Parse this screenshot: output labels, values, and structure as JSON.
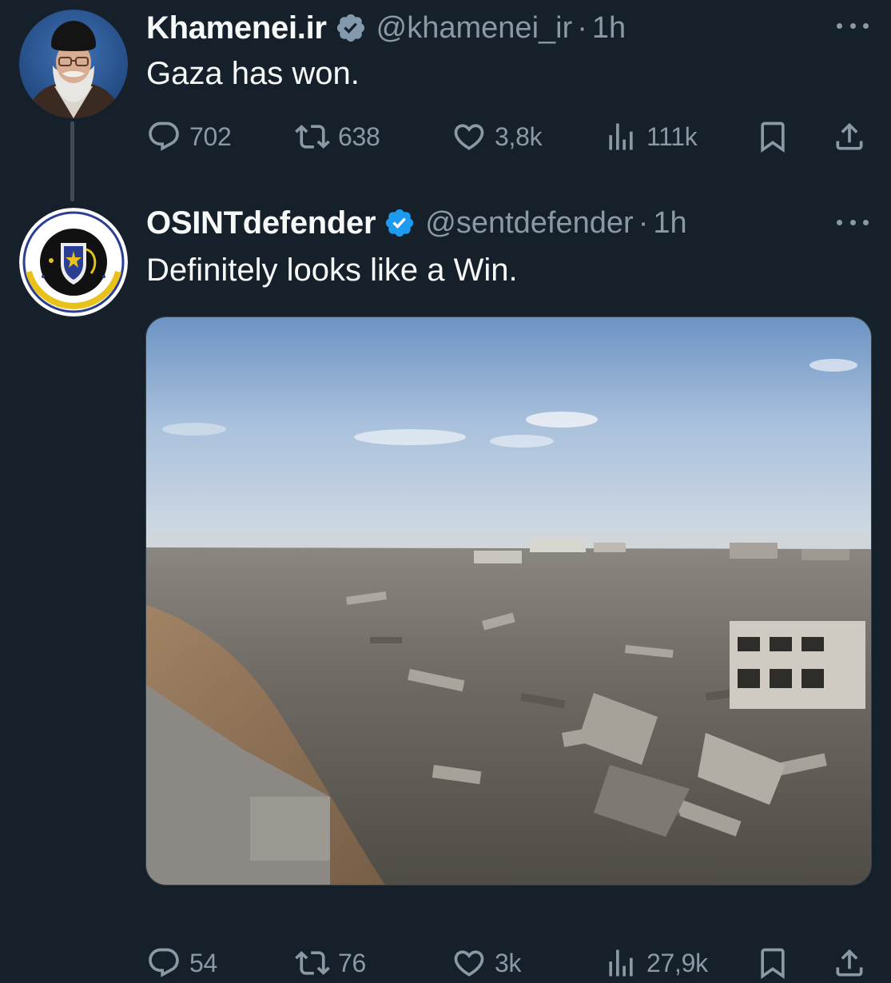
{
  "tweets": [
    {
      "display_name": "Khamenei.ir",
      "verified": "gray",
      "handle": "@khamenei_ir",
      "separator": "·",
      "time": "1h",
      "text": "Gaza has won.",
      "actions": {
        "replies": "702",
        "reposts": "638",
        "likes": "3,8k",
        "views": "111k"
      }
    },
    {
      "display_name": "OSINTdefender",
      "verified": "blue",
      "handle": "@sentdefender",
      "separator": "·",
      "time": "1h",
      "text": "Definitely looks like a Win.",
      "actions": {
        "replies": "54",
        "reposts": "76",
        "likes": "3k",
        "views": "27,9k"
      }
    }
  ],
  "colors": {
    "background": "#15202b",
    "text_primary": "#f7f9f9",
    "text_secondary": "#8b98a5",
    "verified_blue": "#1d9bf0",
    "verified_gray": "#829aab",
    "thread_line": "#3f4a56"
  },
  "icons": {
    "reply": "speech-bubble-icon",
    "repost": "repost-arrows-icon",
    "like": "heart-icon",
    "views": "bar-chart-icon",
    "bookmark": "bookmark-icon",
    "share": "share-upload-icon",
    "more": "more-dots-icon"
  }
}
